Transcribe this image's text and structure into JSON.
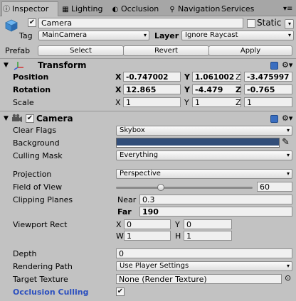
{
  "tabs": [
    {
      "label": "Inspector",
      "icon": "info-icon",
      "active": true
    },
    {
      "label": "Lighting",
      "icon": "grid-icon",
      "active": false
    },
    {
      "label": "Occlusion",
      "icon": "circle-icon",
      "active": false
    },
    {
      "label": "Navigation",
      "icon": "navigation-icon",
      "active": false
    },
    {
      "label": "Services",
      "icon": "",
      "active": false
    }
  ],
  "object": {
    "name": "Camera",
    "active_checked": true,
    "static_label": "Static",
    "tag_label": "Tag",
    "tag_value": "MainCamera",
    "layer_label": "Layer",
    "layer_value": "Ignore Raycast",
    "prefab_label": "Prefab",
    "prefab_buttons": [
      "Select",
      "Revert",
      "Apply"
    ]
  },
  "transform": {
    "title": "Transform",
    "rows": [
      {
        "label": "Position",
        "bold": true,
        "x": "-0.747002",
        "y": "1.061002",
        "z": "-3.475997"
      },
      {
        "label": "Rotation",
        "bold": true,
        "x": "12.865",
        "y": "-4.479",
        "z": "-0.765"
      },
      {
        "label": "Scale",
        "bold": false,
        "x": "1",
        "y": "1",
        "z": "1"
      }
    ]
  },
  "camera": {
    "title": "Camera",
    "enabled": true,
    "clear_flags_label": "Clear Flags",
    "clear_flags_value": "Skybox",
    "background_label": "Background",
    "background_color": "#314d79",
    "culling_mask_label": "Culling Mask",
    "culling_mask_value": "Everything",
    "projection_label": "Projection",
    "projection_value": "Perspective",
    "fov_label": "Field of View",
    "fov_value": "60",
    "fov_fraction": 0.33,
    "clipping_label": "Clipping Planes",
    "near_label": "Near",
    "near_value": "0.3",
    "far_label": "Far",
    "far_value": "190",
    "viewport_label": "Viewport Rect",
    "viewport": {
      "x": "0",
      "y": "0",
      "w": "1",
      "h": "1"
    },
    "depth_label": "Depth",
    "depth_value": "0",
    "rendering_path_label": "Rendering Path",
    "rendering_path_value": "Use Player Settings",
    "target_texture_label": "Target Texture",
    "target_texture_value": "None (Render Texture)",
    "occlusion_label": "Occlusion Culling",
    "occlusion_checked": true
  },
  "axis_labels": {
    "x": "X",
    "y": "Y",
    "z": "Z",
    "w": "W",
    "h": "H"
  },
  "colors": {
    "accent": "#3a6ec0",
    "occlusion_label": "#2b4fbf"
  }
}
